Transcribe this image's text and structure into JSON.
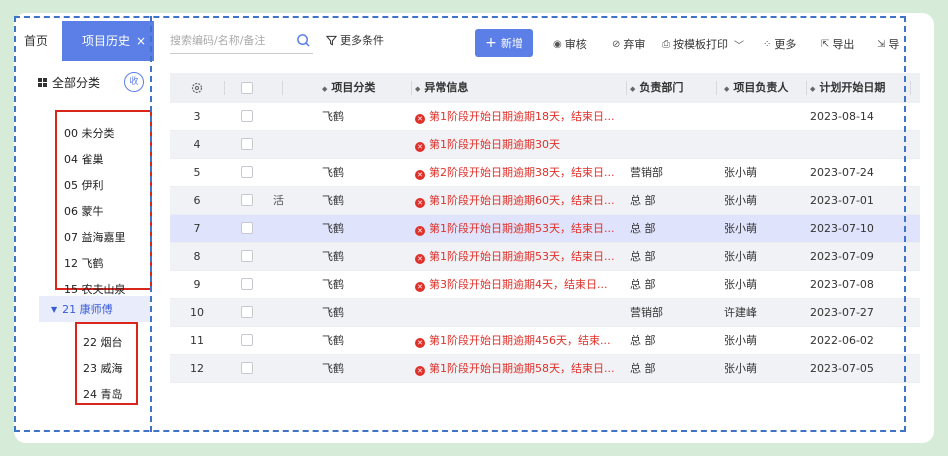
{
  "tabs": [
    {
      "label": "首页"
    },
    {
      "label": "项目历史",
      "close": "×"
    }
  ],
  "tree": {
    "title": "全部分类",
    "collapse_label": "收",
    "items_group1": [
      "00 未分类",
      "04 雀巢",
      "05 伊利",
      "06 蒙牛",
      "07 益海嘉里",
      "12 飞鹤",
      "15 农夫山泉"
    ],
    "parent": "21 康师傅",
    "children": [
      "22 烟台",
      "23 威海",
      "24 青岛"
    ]
  },
  "toolbar": {
    "search_placeholder": "搜索编码/名称/备注",
    "filter": "更多条件",
    "new": "新增",
    "audit": "审核",
    "unaudit": "弃审",
    "print": "按模板打印",
    "more": "更多",
    "export": "导出",
    "import": "导"
  },
  "table": {
    "headers": [
      "项目分类",
      "异常信息",
      "负责部门",
      "项目负责人",
      "计划开始日期"
    ],
    "rows": [
      {
        "no": "3",
        "cat": "飞鹤",
        "err": "第1阶段开始日期逾期18天，结束日...",
        "dept": "",
        "owner": "",
        "date": "2023-08-14"
      },
      {
        "no": "4",
        "cat": "",
        "err": "第1阶段开始日期逾期30天",
        "dept": "",
        "owner": "",
        "date": ""
      },
      {
        "no": "5",
        "cat": "飞鹤",
        "err": "第2阶段开始日期逾期38天，结束日...",
        "dept": "营销部",
        "owner": "张小萌",
        "date": "2023-07-24"
      },
      {
        "no": "6",
        "cat": "飞鹤",
        "err": "第1阶段开始日期逾期60天，结束日...",
        "dept": "总 部",
        "owner": "张小萌",
        "date": "2023-07-01",
        "extra": "活"
      },
      {
        "no": "7",
        "cat": "飞鹤",
        "err": "第1阶段开始日期逾期53天，结束日...",
        "dept": "总 部",
        "owner": "张小萌",
        "date": "2023-07-10"
      },
      {
        "no": "8",
        "cat": "飞鹤",
        "err": "第1阶段开始日期逾期53天，结束日...",
        "dept": "总 部",
        "owner": "张小萌",
        "date": "2023-07-09"
      },
      {
        "no": "9",
        "cat": "飞鹤",
        "err": "第3阶段开始日期逾期4天，结束日...",
        "dept": "总 部",
        "owner": "张小萌",
        "date": "2023-07-08"
      },
      {
        "no": "10",
        "cat": "飞鹤",
        "err": "",
        "dept": "营销部",
        "owner": "许建峰",
        "date": "2023-07-27"
      },
      {
        "no": "11",
        "cat": "飞鹤",
        "err": "第1阶段开始日期逾期456天，结束...",
        "dept": "总 部",
        "owner": "张小萌",
        "date": "2022-06-02"
      },
      {
        "no": "12",
        "cat": "飞鹤",
        "err": "第1阶段开始日期逾期58天，结束日...",
        "dept": "总 部",
        "owner": "张小萌",
        "date": "2023-07-05"
      }
    ]
  },
  "colors": {
    "accent": "#5b7fe6",
    "error": "#e0302a",
    "highlight_box": "#d9251c",
    "dash": "#3f73c7"
  }
}
